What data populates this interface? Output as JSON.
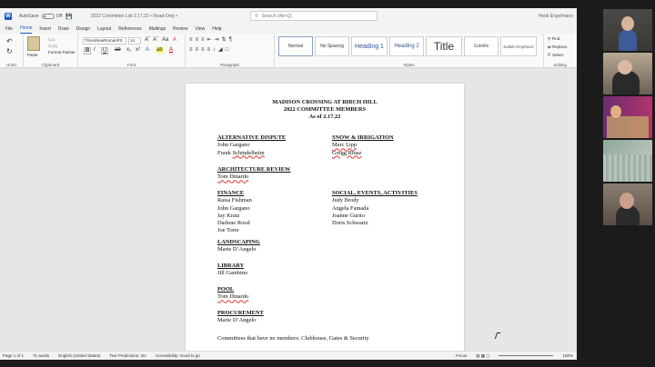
{
  "titlebar": {
    "autosave": "AutoSave",
    "toggle": "Off",
    "doc_title": "2022 Committee List 2.17.22  •  Read-Only  •",
    "search_placeholder": "Search (Alt+Q)",
    "user": "Heidi Engelmann"
  },
  "tabs": [
    "File",
    "Home",
    "Insert",
    "Draw",
    "Design",
    "Layout",
    "References",
    "Mailings",
    "Review",
    "View",
    "Help"
  ],
  "ribbon": {
    "undo_label": "Undo",
    "clipboard": {
      "paste": "Paste",
      "cut": "Cut",
      "copy": "Copy",
      "format_painter": "Format Painter",
      "label": "Clipboard"
    },
    "font": {
      "name": "TimesNewRomanPS",
      "size": "14",
      "label": "Font"
    },
    "paragraph_label": "Paragraph",
    "styles": [
      "Normal",
      "No Spacing",
      "Heading 1",
      "Heading 2",
      "Title",
      "Subtitle",
      "Subtle Emphasis"
    ],
    "styles_label": "Styles",
    "editing": {
      "find": "Find",
      "replace": "Replace",
      "select": "Select",
      "label": "Editing"
    }
  },
  "document": {
    "title1": "MADISON CROSSING AT BIRCH HILL",
    "title2": "2022 COMMITTEE MEMBERS",
    "title3": "As of 2.17.22",
    "left": [
      {
        "heading": "ALTERNATIVE DISPUTE",
        "members": [
          "John Gargano",
          "Frank Schindelheim"
        ]
      },
      {
        "heading": "ARCHITECTURE REVIEW",
        "members": [
          "Tom Dinardo"
        ]
      },
      {
        "heading": "FINANCE",
        "members": [
          "Raisa Fishman",
          "John Gargano",
          "Jay Kratz",
          "Darlene Rood",
          "Joe Torre"
        ]
      },
      {
        "heading": "LANDSCAPING",
        "members": [
          "Marie D’Angelo"
        ]
      },
      {
        "heading": "LIBRARY",
        "members": [
          "Jill Gambino"
        ]
      },
      {
        "heading": "POOL",
        "members": [
          "Tom Dinardo"
        ]
      },
      {
        "heading": "PROCUREMENT",
        "members": [
          "Marie D’Angelo"
        ]
      }
    ],
    "right": [
      {
        "heading": "SNOW & IRRIGATION",
        "members": [
          "Marc Lipp",
          "Gregg Rinaz"
        ]
      },
      {
        "heading": "SOCIAL, EVENTS, ACTIVITIES",
        "members": [
          "Judy Brody",
          "Angela Famada",
          "Joanne Gurito",
          "Doris Schwartz"
        ]
      }
    ],
    "footer": "Committees that have no members: Clubhouse, Gates & Security"
  },
  "status": {
    "page": "Page 1 of 1",
    "words": "71 words",
    "language": "English (United States)",
    "predictions": "Text Predictions: On",
    "accessibility": "Accessibility: Good to go",
    "focus": "Focus",
    "zoom": "100%"
  }
}
